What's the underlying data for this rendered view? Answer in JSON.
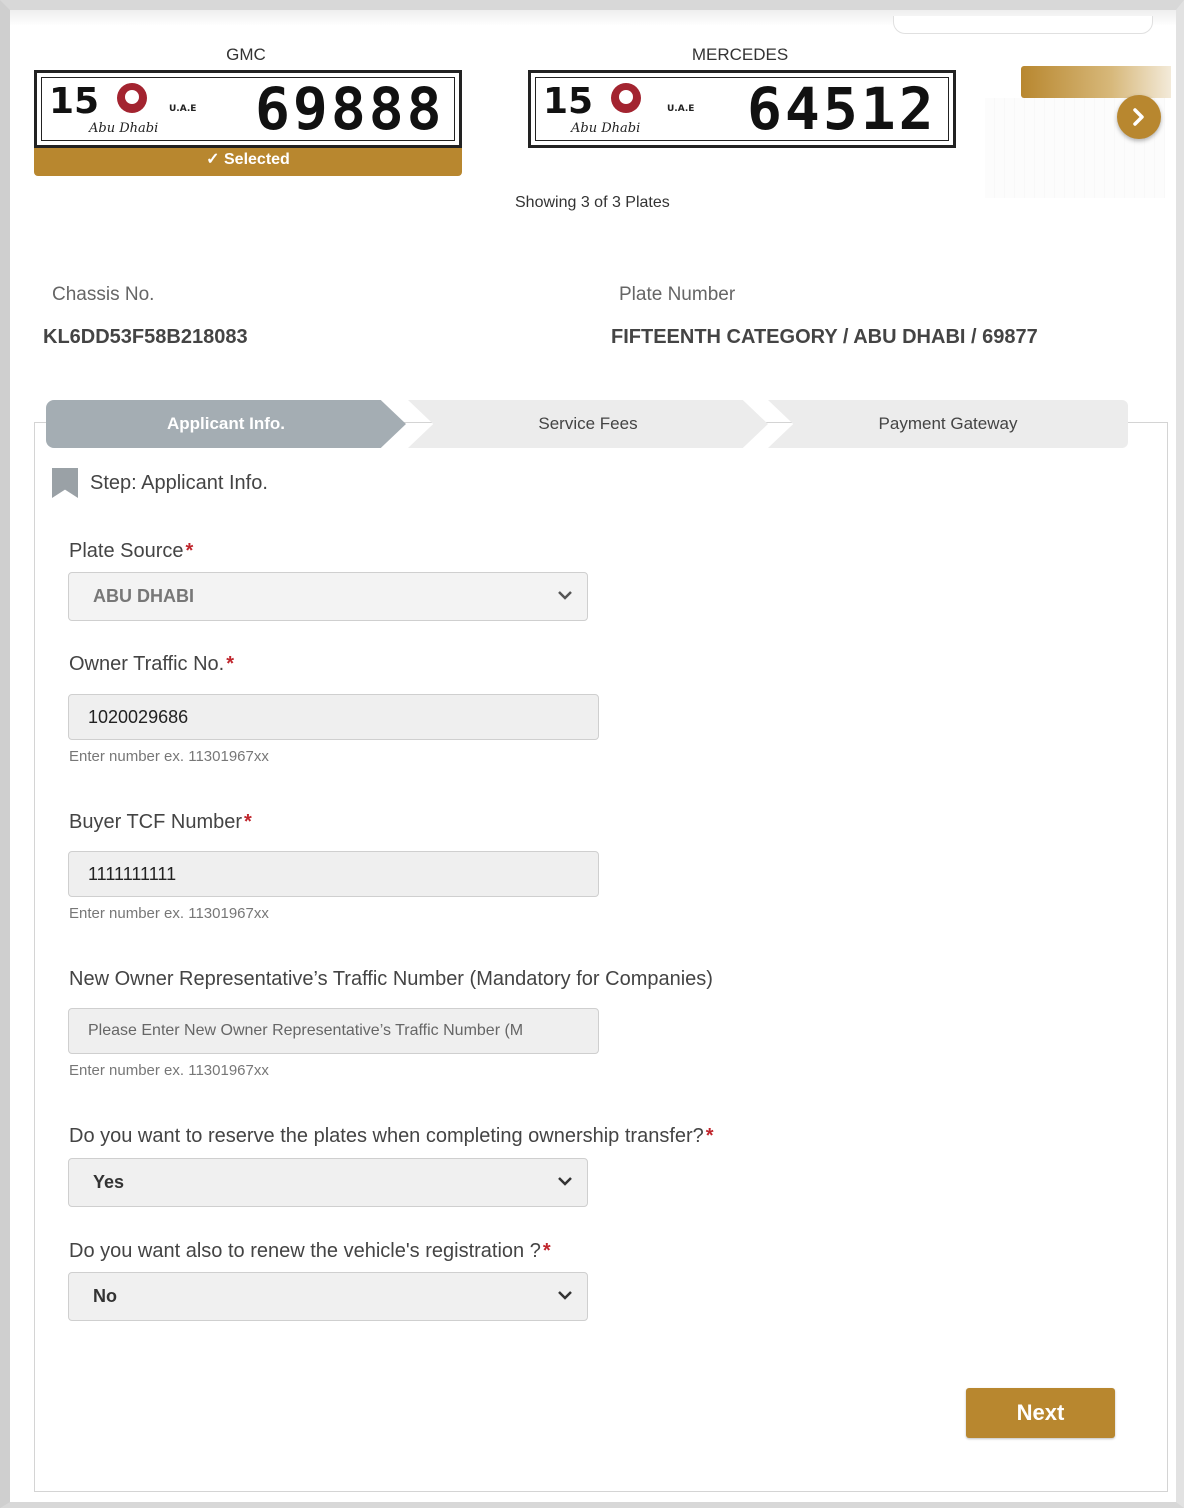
{
  "plates": [
    {
      "make": "GMC",
      "category": "15",
      "emirate_script": "Abu Dhabi",
      "country_code": "U.A.E",
      "number": "69888",
      "selected": true
    },
    {
      "make": "MERCEDES",
      "category": "15",
      "emirate_script": "Abu Dhabi",
      "country_code": "U.A.E",
      "number": "64512",
      "selected": false
    }
  ],
  "selected_label": "✓ Selected",
  "showing_text": "Showing 3 of 3 Plates",
  "vehicle_info": {
    "chassis_label": "Chassis No.",
    "chassis_value": "KL6DD53F58B218083",
    "plate_label": "Plate Number",
    "plate_value": "FIFTEENTH CATEGORY / ABU DHABI / 69877"
  },
  "steps": [
    {
      "label": "Applicant Info.",
      "active": true
    },
    {
      "label": "Service Fees",
      "active": false
    },
    {
      "label": "Payment Gateway",
      "active": false
    }
  ],
  "step_heading": "Step: Applicant Info.",
  "form": {
    "plate_source": {
      "label": "Plate Source",
      "value": "ABU DHABI",
      "required": "*"
    },
    "owner_traffic": {
      "label": "Owner Traffic No.",
      "value": "1020029686",
      "hint": "Enter number ex. 11301967xx",
      "required": "*"
    },
    "buyer_tcf": {
      "label": "Buyer TCF Number",
      "value": "1111111111",
      "hint": "Enter number ex. 11301967xx",
      "required": "*"
    },
    "representative": {
      "label": "New Owner Representative’s Traffic Number (Mandatory for Companies)",
      "placeholder": "Please Enter New Owner Representative’s Traffic Number (M",
      "hint": "Enter number ex. 11301967xx"
    },
    "reserve_plates": {
      "label": "Do you want to reserve the plates when completing ownership transfer?",
      "value": "Yes",
      "required": "*"
    },
    "renew_registration": {
      "label": "Do you want also to renew the vehicle's registration ?",
      "value": "No",
      "required": "*"
    }
  },
  "next_label": "Next",
  "colors": {
    "gold": "#b8872f",
    "step_active": "#a4adb3",
    "required": "#c0262d"
  },
  "icons": {
    "carousel_next": "chevron-right-icon",
    "step_marker": "bookmark-icon",
    "select": "chevron-down-icon"
  }
}
